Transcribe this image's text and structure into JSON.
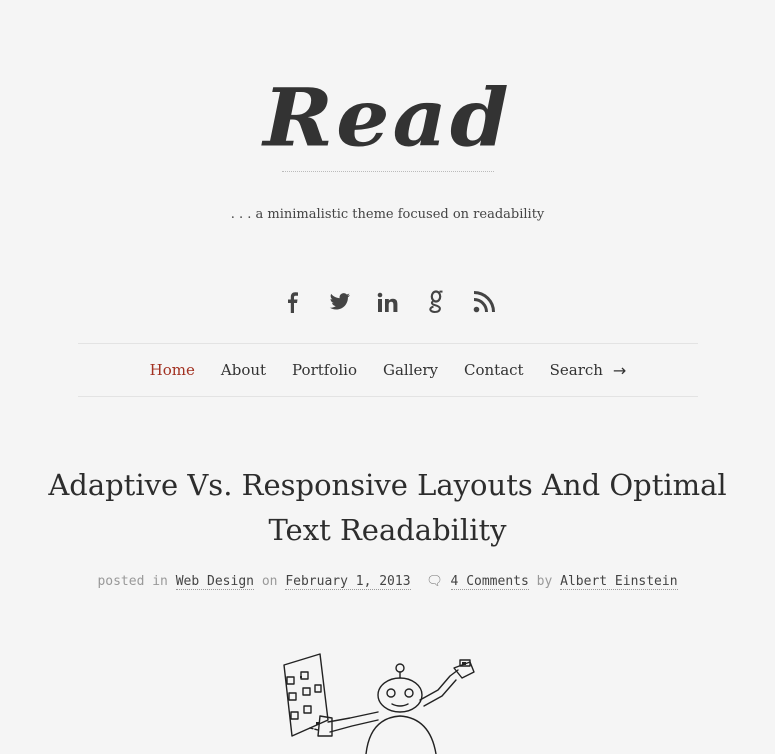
{
  "site": {
    "logo": "Read",
    "tagline": ". . . a minimalistic theme focused on readability"
  },
  "social": [
    {
      "name": "facebook-icon",
      "glyph": "f"
    },
    {
      "name": "twitter-icon",
      "glyph": "🐦"
    },
    {
      "name": "linkedin-icon",
      "glyph": "in"
    },
    {
      "name": "google-icon",
      "glyph": "g"
    },
    {
      "name": "rss-icon",
      "glyph": "rss"
    }
  ],
  "nav": {
    "items": [
      "Home",
      "About",
      "Portfolio",
      "Gallery",
      "Contact"
    ],
    "search_label": "Search",
    "search_arrow": "→"
  },
  "post": {
    "title": "Adaptive Vs. Responsive Layouts And Optimal Text Readability",
    "meta": {
      "posted_in": "posted in",
      "category": "Web Design",
      "on": "on",
      "date": "February 1, 2013",
      "comments": "4 Comments",
      "by": "by",
      "author": "Albert Einstein"
    }
  },
  "colors": {
    "background": "#f5f5f5",
    "accent": "#a23121",
    "text": "#2f2f2f"
  }
}
